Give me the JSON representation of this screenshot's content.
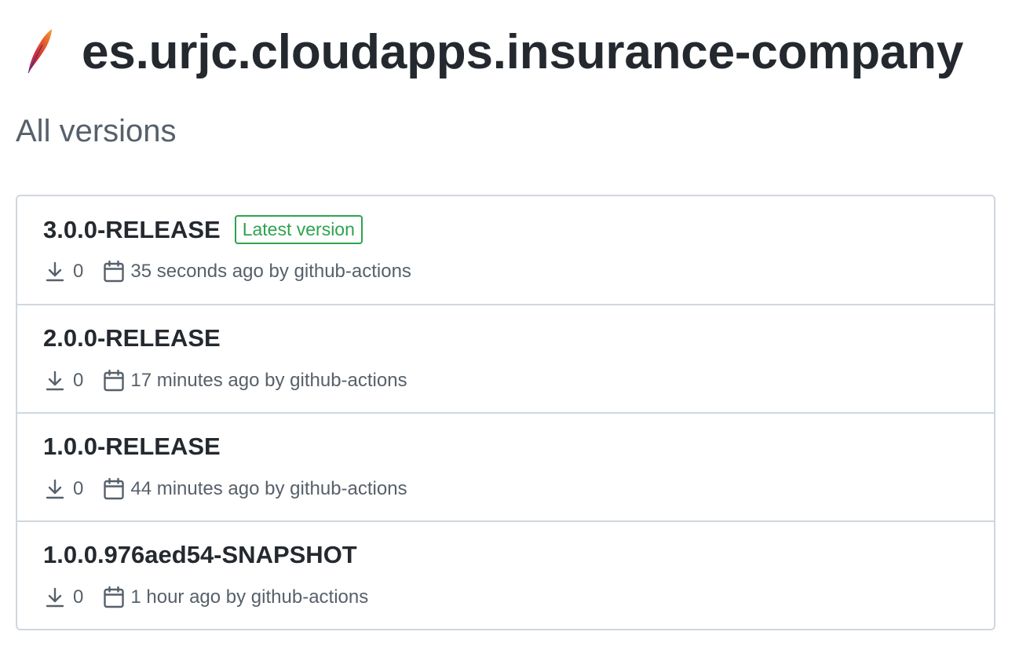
{
  "header": {
    "title": "es.urjc.cloudapps.insurance-company",
    "logo_icon": "apache-feather-icon"
  },
  "section": {
    "title": "All versions"
  },
  "colors": {
    "text_primary": "#24292f",
    "text_secondary": "#57606a",
    "border": "#d0d7de",
    "badge_green": "#2da44e"
  },
  "versions": [
    {
      "name": "3.0.0-RELEASE",
      "badge": "Latest version",
      "downloads": "0",
      "published": "35 seconds ago by github-actions"
    },
    {
      "name": "2.0.0-RELEASE",
      "downloads": "0",
      "published": "17 minutes ago by github-actions"
    },
    {
      "name": "1.0.0-RELEASE",
      "downloads": "0",
      "published": "44 minutes ago by github-actions"
    },
    {
      "name": "1.0.0.976aed54-SNAPSHOT",
      "downloads": "0",
      "published": "1 hour ago by github-actions"
    }
  ]
}
